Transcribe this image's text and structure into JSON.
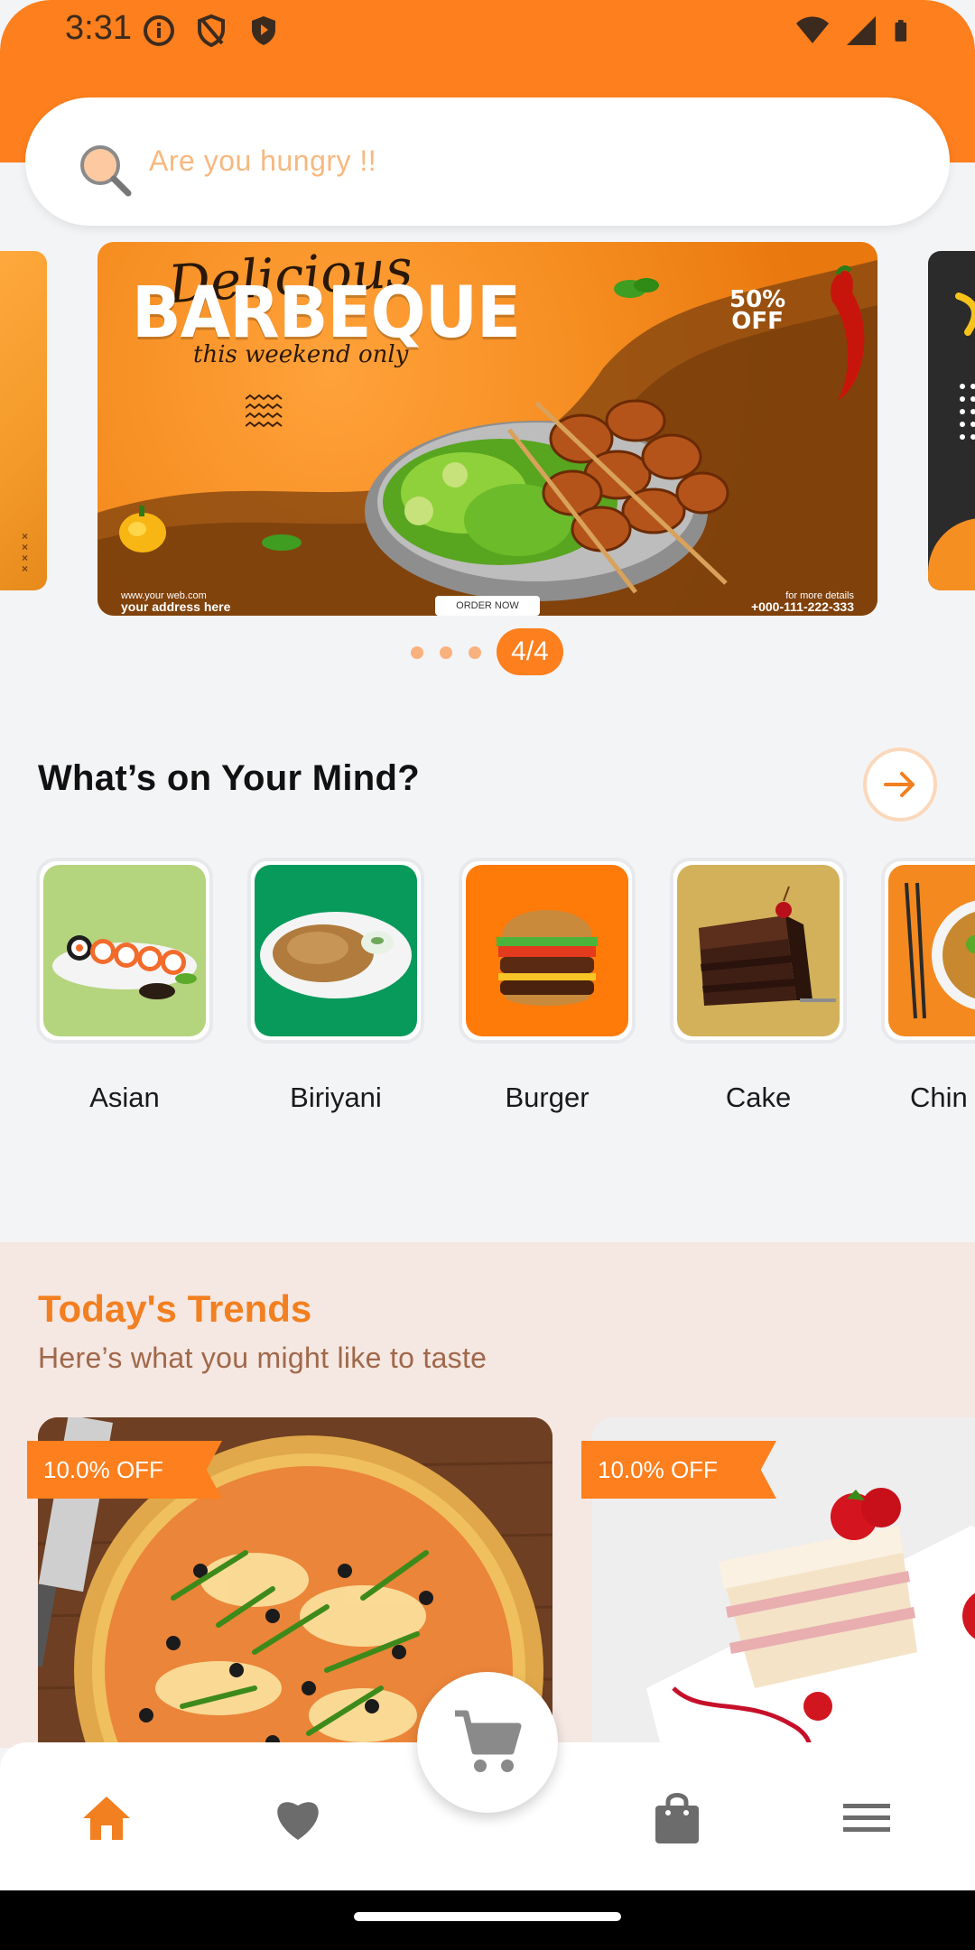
{
  "status_bar": {
    "time": "3:31",
    "left_icons": [
      "info-icon",
      "shield-icon",
      "shield-filled-icon"
    ],
    "right_icons": [
      "wifi-icon",
      "signal-icon",
      "battery-icon"
    ]
  },
  "colors": {
    "brand_orange": "#fd7f1d",
    "soft_orange": "#f9b17e",
    "trends_bg": "#f5e7e2",
    "page_bg": "#f3f4f6"
  },
  "search": {
    "placeholder": "Are you hungry !!",
    "icon": "search-icon"
  },
  "carousel": {
    "current": "4/4",
    "total_dots": 3,
    "banner": {
      "script_title": "Delicious",
      "title": "BARBEQUE",
      "subtitle": "this weekend only",
      "discount_line1": "50%",
      "discount_line2": "OFF",
      "website": "www.your web.com",
      "address": "your address here",
      "cta": "ORDER NOW",
      "details_label": "for more details",
      "phone": "+000-111-222-333"
    }
  },
  "mind_section": {
    "title": "What’s on Your Mind?",
    "arrow_icon": "arrow-right-icon",
    "categories": [
      {
        "label": "Asian",
        "bg": "#b5d47e"
      },
      {
        "label": "Biriyani",
        "bg": "#079a5a"
      },
      {
        "label": "Burger",
        "bg": "#fe7a09"
      },
      {
        "label": "Cake",
        "bg": "#d2b15a"
      },
      {
        "label": "Chin",
        "bg": "#f4891f"
      }
    ]
  },
  "trends": {
    "title": "Today's Trends",
    "subtitle": "Here’s what you might like to taste",
    "items": [
      {
        "badge": "10.0% OFF",
        "image": "pizza"
      },
      {
        "badge": "10.0% OFF",
        "image": "strawberry-cake"
      }
    ]
  },
  "bottom_nav": {
    "items": [
      {
        "icon": "home-icon",
        "active": true
      },
      {
        "icon": "heart-icon",
        "active": false
      },
      {
        "icon": "cart-icon",
        "active": false
      },
      {
        "icon": "shopping-bag-icon",
        "active": false
      },
      {
        "icon": "menu-icon",
        "active": false
      }
    ]
  }
}
